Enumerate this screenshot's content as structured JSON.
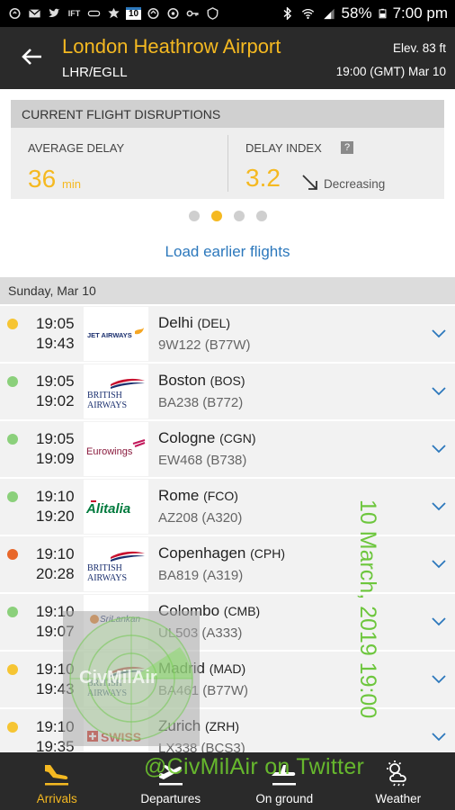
{
  "status_bar": {
    "battery": "58%",
    "clock": "7:00 pm",
    "left_icons": [
      "notification-icon",
      "gmail-icon",
      "twitter-icon",
      "ift-icon",
      "link-icon",
      "settings-icon",
      "calendar-icon",
      "sync-icon",
      "location-icon",
      "key-icon",
      "vpn-icon"
    ],
    "calendar_day": "10"
  },
  "header": {
    "title": "London Heathrow Airport",
    "codes": "LHR/EGLL",
    "elevation": "Elev. 83 ft",
    "timestamp": "19:00 (GMT) Mar 10"
  },
  "disruptions": {
    "heading": "CURRENT FLIGHT DISRUPTIONS",
    "avg_label": "AVERAGE DELAY",
    "avg_value": "36",
    "avg_unit": "min",
    "index_label": "DELAY INDEX",
    "index_help": "?",
    "index_value": "3.2",
    "index_trend": "Decreasing"
  },
  "pager": {
    "count": 4,
    "active": 1
  },
  "load_earlier": "Load earlier flights",
  "date_header": "Sunday, Mar 10",
  "flights": [
    {
      "scheduled": "19:05",
      "actual": "19:43",
      "status_color": "#f6c533",
      "airline": "JET AIRWAYS",
      "logo": "jet",
      "city": "Delhi",
      "code": "(DEL)",
      "flight": "9W122 (B77W)"
    },
    {
      "scheduled": "19:05",
      "actual": "19:02",
      "status_color": "#8bd07b",
      "airline": "BRITISH AIRWAYS",
      "logo": "ba",
      "city": "Boston",
      "code": "(BOS)",
      "flight": "BA238 (B772)"
    },
    {
      "scheduled": "19:05",
      "actual": "19:09",
      "status_color": "#8bd07b",
      "airline": "Eurowings",
      "logo": "eurowings",
      "city": "Cologne",
      "code": "(CGN)",
      "flight": "EW468 (B738)"
    },
    {
      "scheduled": "19:10",
      "actual": "19:20",
      "status_color": "#8bd07b",
      "airline": "Alitalia",
      "logo": "alitalia",
      "city": "Rome",
      "code": "(FCO)",
      "flight": "AZ208 (A320)"
    },
    {
      "scheduled": "19:10",
      "actual": "20:28",
      "status_color": "#e8672a",
      "airline": "BRITISH AIRWAYS",
      "logo": "ba",
      "city": "Copenhagen",
      "code": "(CPH)",
      "flight": "BA819 (A319)"
    },
    {
      "scheduled": "19:10",
      "actual": "19:07",
      "status_color": "#8bd07b",
      "airline": "SriLankan",
      "logo": "srilankan",
      "city": "Colombo",
      "code": "(CMB)",
      "flight": "UL503 (A333)"
    },
    {
      "scheduled": "19:10",
      "actual": "19:43",
      "status_color": "#f6c533",
      "airline": "BRITISH AIRWAYS",
      "logo": "ba",
      "city": "Madrid",
      "code": "(MAD)",
      "flight": "BA461 (B77W)"
    },
    {
      "scheduled": "19:10",
      "actual": "19:35",
      "status_color": "#f6c533",
      "airline": "SWISS",
      "logo": "swiss",
      "city": "Zurich",
      "code": "(ZRH)",
      "flight": "LX338 (BCS3)"
    }
  ],
  "watermark": {
    "date": "10 March, 2019 19:00",
    "handle": "@CivMilAir on Twitter",
    "radar_text": "CivMilAir"
  },
  "nav": [
    {
      "label": "Arrivals",
      "icon": "arrivals-icon",
      "active": true
    },
    {
      "label": "Departures",
      "icon": "departures-icon",
      "active": false
    },
    {
      "label": "On ground",
      "icon": "on-ground-icon",
      "active": false
    },
    {
      "label": "Weather",
      "icon": "weather-icon",
      "active": false
    }
  ],
  "colors": {
    "accent": "#f5b921",
    "header_bg": "#2a2a2a",
    "link": "#2c78bc",
    "status_green": "#8bd07b",
    "status_yellow": "#f6c533",
    "status_orange": "#e8672a",
    "watermark_green": "#6fcb2e"
  }
}
